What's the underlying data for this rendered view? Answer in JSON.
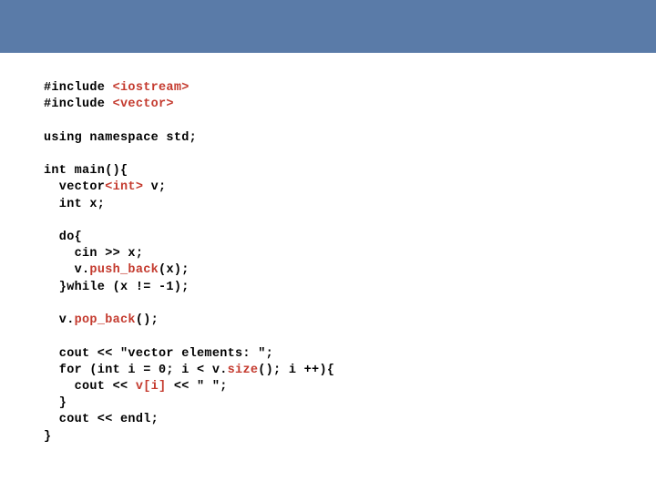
{
  "code": {
    "l1_p1": "#include ",
    "l1_p2": "<iostream>",
    "l2_p1": "#include ",
    "l2_p2": "<vector>",
    "l3": "using namespace std;",
    "l4": "int main(){",
    "l5_p1": "  vector",
    "l5_p2": "<int>",
    "l5_p3": " v;",
    "l6": "  int x;",
    "l7": "  do{",
    "l8": "    cin >> x;",
    "l9_p1": "    v.",
    "l9_p2": "push_back",
    "l9_p3": "(x);",
    "l10": "  }while (x != -1);",
    "l11_p1": "  v.",
    "l11_p2": "pop_back",
    "l11_p3": "();",
    "l12": "  cout << \"vector elements: \";",
    "l13_p1": "  for (int i = 0; i < v.",
    "l13_p2": "size",
    "l13_p3": "(); i ++){",
    "l14_p1": "    cout << ",
    "l14_p2": "v[i]",
    "l14_p3": " << \" \";",
    "l15": "  }",
    "l16": "  cout << endl;",
    "l17": "}"
  }
}
